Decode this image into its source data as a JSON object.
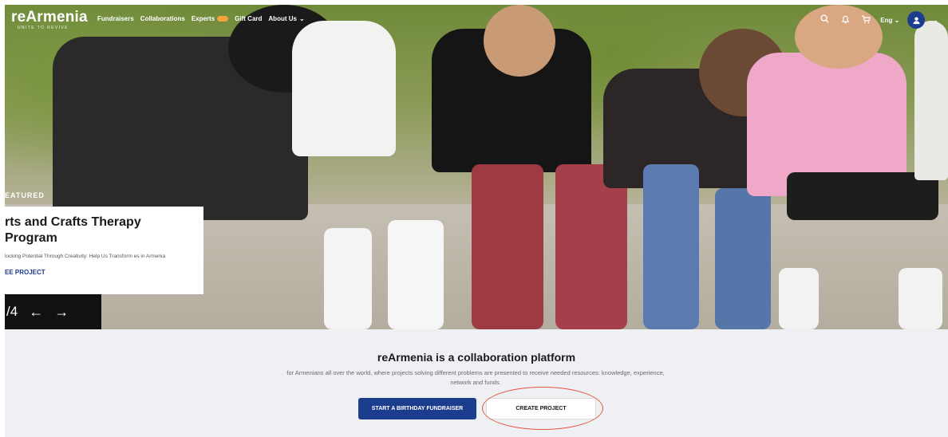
{
  "brand": {
    "name": "reArmenia",
    "tagline": "UNITE TO REVIVE"
  },
  "nav": {
    "items": [
      {
        "label": "Fundraisers",
        "badge": false,
        "dropdown": false
      },
      {
        "label": "Collaborations",
        "badge": false,
        "dropdown": false
      },
      {
        "label": "Experts",
        "badge": true,
        "dropdown": false
      },
      {
        "label": "Gift Card",
        "badge": false,
        "dropdown": false
      },
      {
        "label": "About Us",
        "badge": false,
        "dropdown": true
      }
    ],
    "language": "Eng",
    "icons": [
      "search-icon",
      "bell-icon",
      "cart-icon",
      "user-icon"
    ]
  },
  "featured": {
    "label": "EATURED",
    "title": "rts and Crafts Therapy Program",
    "description": "locking Potential Through Creativity: Help Us Transform es in Armenia",
    "link": "EE PROJECT",
    "pager": "/4"
  },
  "lower": {
    "title": "reArmenia is a collaboration platform",
    "description": "for Armenians all over the world, where projects solving different problems are presented to receive needed resources: knowledge, experience, network and funds.",
    "primary_button": "START A BIRTHDAY FUNDRAISER",
    "secondary_button": "CREATE PROJECT"
  },
  "colors": {
    "brand_blue": "#1c3d8e",
    "highlight": "#e05a3a",
    "badge": "#f2a43a"
  }
}
